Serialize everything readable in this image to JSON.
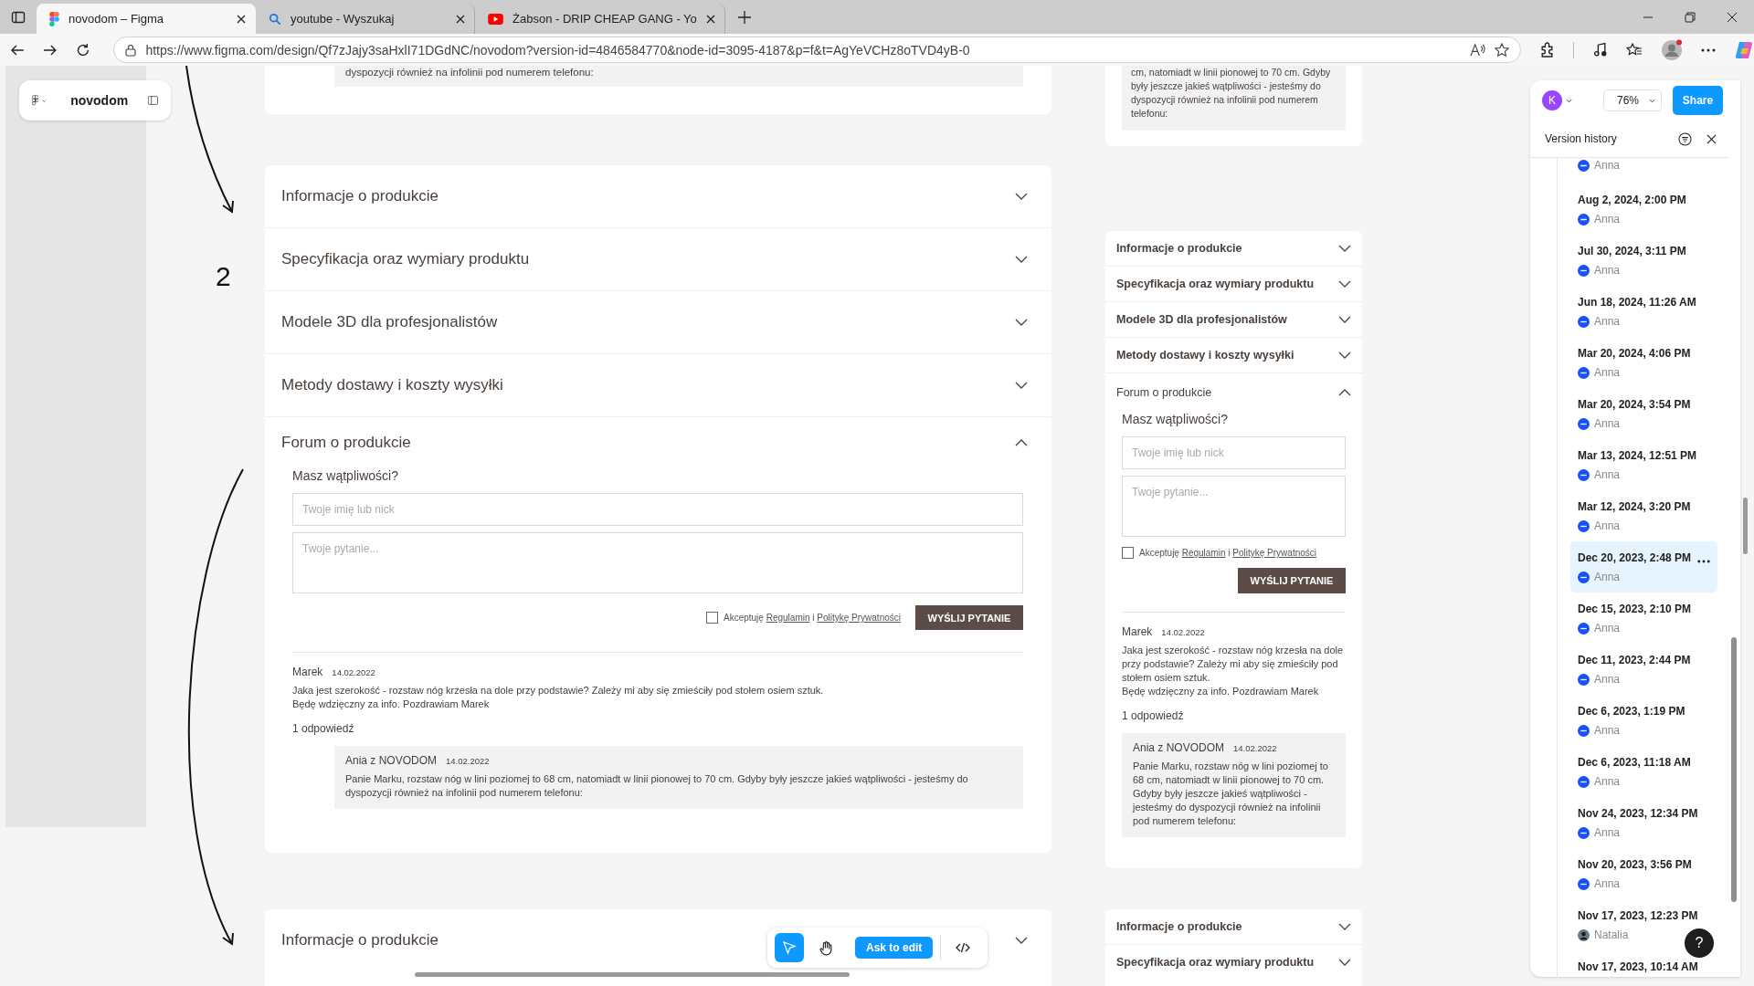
{
  "browser": {
    "tabs": [
      {
        "title": "novodom – Figma",
        "kind": "figma",
        "selected": true
      },
      {
        "title": "youtube - Wyszukaj",
        "kind": "search",
        "selected": false
      },
      {
        "title": "Żabson - DRIP CHEAP GANG - Yo",
        "kind": "video",
        "selected": false
      }
    ],
    "url": "https://www.figma.com/design/Qf7zJajy3saHxlI71DGdNC/novodom?version-id=4846584770&node-id=3095-4187&p=f&t=AgYeVCHz8oTVD4yB-0"
  },
  "figma": {
    "file_name": "novodom",
    "user_initial": "K",
    "zoom": "76%",
    "share": "Share",
    "version_history": {
      "title": "Version history",
      "versions": [
        {
          "author": "Anna",
          "kind": "logo",
          "selected": false
        },
        {
          "date": "Aug 2, 2024, 2:00 PM",
          "author": "Anna",
          "kind": "logo",
          "selected": false
        },
        {
          "date": "Jul 30, 2024, 3:11 PM",
          "author": "Anna",
          "kind": "logo",
          "selected": false
        },
        {
          "date": "Jun 18, 2024, 11:26 AM",
          "author": "Anna",
          "kind": "logo",
          "selected": false
        },
        {
          "date": "Mar 20, 2024, 4:06 PM",
          "author": "Anna",
          "kind": "logo",
          "selected": false
        },
        {
          "date": "Mar 20, 2024, 3:54 PM",
          "author": "Anna",
          "kind": "logo",
          "selected": false
        },
        {
          "date": "Mar 13, 2024, 12:51 PM",
          "author": "Anna",
          "kind": "logo",
          "selected": false
        },
        {
          "date": "Mar 12, 2024, 3:20 PM",
          "author": "Anna",
          "kind": "logo",
          "selected": false
        },
        {
          "date": "Dec 20, 2023, 2:48 PM",
          "author": "Anna",
          "kind": "logo",
          "selected": true
        },
        {
          "date": "Dec 15, 2023, 2:10 PM",
          "author": "Anna",
          "kind": "logo",
          "selected": false
        },
        {
          "date": "Dec 11, 2023, 2:44 PM",
          "author": "Anna",
          "kind": "logo",
          "selected": false
        },
        {
          "date": "Dec 6, 2023, 1:19 PM",
          "author": "Anna",
          "kind": "logo",
          "selected": false
        },
        {
          "date": "Dec 6, 2023, 11:18 AM",
          "author": "Anna",
          "kind": "logo",
          "selected": false
        },
        {
          "date": "Nov 24, 2023, 12:34 PM",
          "author": "Anna",
          "kind": "logo",
          "selected": false
        },
        {
          "date": "Nov 20, 2023, 3:56 PM",
          "author": "Anna",
          "kind": "logo",
          "selected": false
        },
        {
          "date": "Nov 17, 2023, 12:23 PM",
          "author": "Natalia",
          "kind": "person",
          "selected": false
        },
        {
          "date": "Nov 17, 2023, 10:14 AM",
          "selected": false
        }
      ]
    },
    "tools": [
      {
        "kind": "move",
        "selected": true
      },
      {
        "kind": "hand",
        "selected": false
      },
      {
        "kind": "ask",
        "label": "Ask to edit"
      },
      {
        "kind": "code",
        "selected": false
      }
    ],
    "help": "?"
  },
  "canvas": {
    "step_label": "2",
    "frames": [
      {
        "kind": "desktop",
        "top_reply_fragment": "dyspozycji również na infolinii pod numerem telefonu:",
        "sections": [
          {
            "title": "Informacje o produkcie",
            "expanded": false
          },
          {
            "title": "Specyfikacja oraz wymiary produktu",
            "expanded": false
          },
          {
            "title": "Modele 3D dla profesjonalistów",
            "expanded": false
          },
          {
            "title": "Metody dostawy i koszty wysyłki",
            "expanded": false
          },
          {
            "title": "Forum o produkcie",
            "expanded": true,
            "content": {
              "heading": "Masz wątpliwości?",
              "name_placeholder": "Twoje imię lub nick",
              "question_placeholder": "Twoje pytanie...",
              "consent": {
                "checked": false,
                "parts": [
                  {
                    "kind": "plain",
                    "text": "Akceptuję"
                  },
                  {
                    "kind": "link",
                    "text": "Regulamin"
                  },
                  {
                    "kind": "plain",
                    "text": "i"
                  },
                  {
                    "kind": "link",
                    "text": "Politykę Prywatności"
                  }
                ]
              },
              "submit": "WYŚLIJ PYTANIE",
              "question": {
                "author": "Marek",
                "date": "14.02.2022",
                "lines": [
                  "Jaka jest szerokość - rozstaw nóg krzesła na dole przy podstawie? Zależy mi aby się zmieściły pod stołem osiem sztuk.",
                  "Będę wdzięczny za info. Pozdrawiam Marek"
                ]
              },
              "replies_count": "1 odpowiedź",
              "reply": {
                "author": "Ania z NOVODOM",
                "date": "14.02.2022",
                "text": "Panie Marku, rozstaw nóg w lini poziomej to 68 cm, natomiadt w linii pionowej to 70 cm. Gdyby były jeszcze jakieś wątpliwości - jesteśmy do dyspozycji również na infolinii pod numerem telefonu:"
              }
            }
          }
        ],
        "bottom_sections": [
          {
            "title": "Informacje o produkcie",
            "expanded": false
          }
        ]
      },
      {
        "kind": "mobile",
        "top_reply_fragment": "cm, natomiadt w linii pionowej to 70 cm. Gdyby były jeszcze jakieś wątpliwości - jesteśmy do dyspozycji również na infolinii pod numerem telefonu:",
        "sections": [
          {
            "title": "Informacje o produkcie",
            "expanded": false
          },
          {
            "title": "Specyfikacja oraz wymiary produktu",
            "expanded": false
          },
          {
            "title": "Modele 3D dla profesjonalistów",
            "expanded": false
          },
          {
            "title": "Metody dostawy i koszty wysyłki",
            "expanded": false
          },
          {
            "title": "Forum o produkcie",
            "expanded": true,
            "content": {
              "heading": "Masz wątpliwości?",
              "name_placeholder": "Twoje imię lub nick",
              "question_placeholder": "Twoje pytanie...",
              "consent": {
                "checked": false,
                "parts": [
                  {
                    "kind": "plain",
                    "text": "Akceptuję"
                  },
                  {
                    "kind": "link",
                    "text": "Regulamin"
                  },
                  {
                    "kind": "plain",
                    "text": "i"
                  },
                  {
                    "kind": "link",
                    "text": "Politykę Prywatności"
                  }
                ]
              },
              "submit": "WYŚLIJ PYTANIE",
              "question": {
                "author": "Marek",
                "date": "14.02.2022",
                "lines": [
                  "Jaka jest szerokość - rozstaw nóg krzesła na dole przy podstawie? Zależy mi aby się zmieściły pod stołem osiem sztuk.",
                  "Będę wdzięczny za info. Pozdrawiam Marek"
                ]
              },
              "replies_count": "1 odpowiedź",
              "reply": {
                "author": "Ania z NOVODOM",
                "date": "14.02.2022",
                "text": "Panie Marku, rozstaw nóg w lini poziomej to 68 cm, natomiadt w linii pionowej to 70 cm. Gdyby były jeszcze jakieś wątpliwości - jesteśmy do dyspozycji również na infolinii pod numerem telefonu:"
              }
            }
          }
        ],
        "bottom_sections": [
          {
            "title": "Informacje o produkcie",
            "expanded": false
          },
          {
            "title": "Specyfikacja oraz wymiary produktu",
            "expanded": false
          }
        ]
      }
    ]
  }
}
